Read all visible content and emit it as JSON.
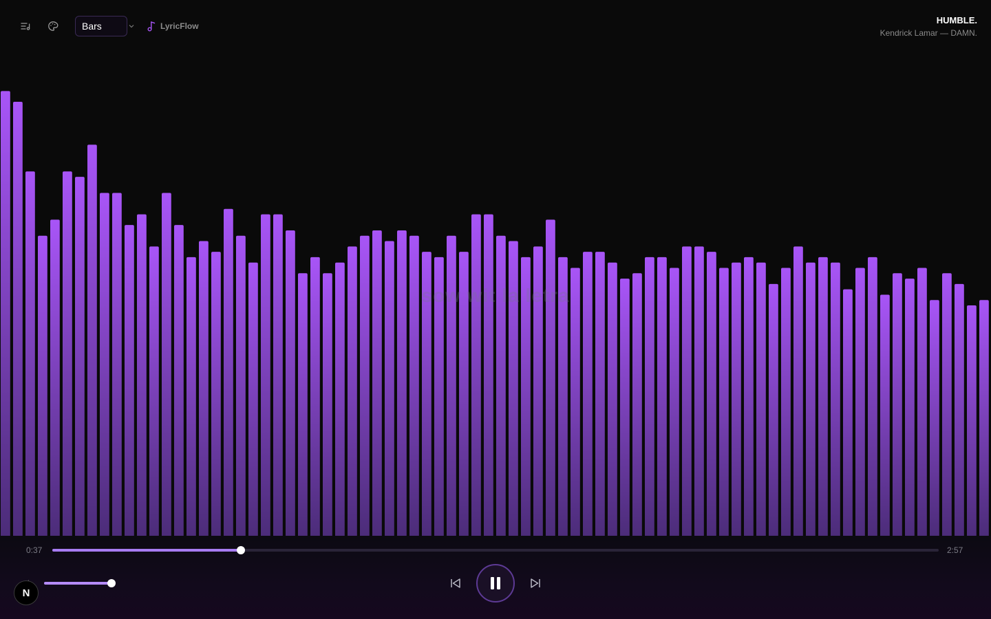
{
  "toolbar": {
    "mode_label": "Bars",
    "brand_label": "LyricFlow"
  },
  "track": {
    "title": "HUMBLE.",
    "subtitle": "Kendrick Lamar — DAMN."
  },
  "lyric_overlay": "sow wit la letra",
  "player": {
    "elapsed": "0:37",
    "duration": "2:57",
    "progress_fraction": 0.213,
    "volume_fraction": 1.0,
    "badge_label": "N"
  },
  "colors": {
    "accent": "#a855f7",
    "bar_top": "#a855f7",
    "bar_bottom": "#4b2c78"
  },
  "visualizer": {
    "baseline_fraction": 0,
    "levels": [
      0.83,
      0.81,
      0.68,
      0.56,
      0.59,
      0.68,
      0.67,
      0.73,
      0.64,
      0.64,
      0.58,
      0.6,
      0.54,
      0.64,
      0.58,
      0.52,
      0.55,
      0.53,
      0.61,
      0.56,
      0.51,
      0.6,
      0.6,
      0.57,
      0.49,
      0.52,
      0.49,
      0.51,
      0.54,
      0.56,
      0.57,
      0.55,
      0.57,
      0.56,
      0.53,
      0.52,
      0.56,
      0.53,
      0.6,
      0.6,
      0.56,
      0.55,
      0.52,
      0.54,
      0.59,
      0.52,
      0.5,
      0.53,
      0.53,
      0.51,
      0.48,
      0.49,
      0.52,
      0.52,
      0.5,
      0.54,
      0.54,
      0.53,
      0.5,
      0.51,
      0.52,
      0.51,
      0.47,
      0.5,
      0.54,
      0.51,
      0.52,
      0.51,
      0.46,
      0.5,
      0.52,
      0.45,
      0.49,
      0.48,
      0.5,
      0.44,
      0.49,
      0.47,
      0.43,
      0.44
    ]
  }
}
